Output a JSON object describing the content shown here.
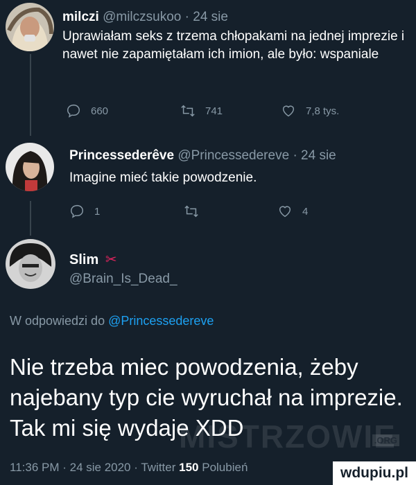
{
  "tweets": [
    {
      "name": "milczi",
      "handle": "@milczsukoo",
      "time": "· 24 sie",
      "text": "Uprawiałam seks z trzema chłopakami na jednej imprezie i nawet nie zapamiętałam ich imion, ale było: wspaniale",
      "replies": "660",
      "retweets": "741",
      "likes": "7,8 tys."
    },
    {
      "name": "Princessederêve",
      "handle": "@Princessedereve",
      "time": "· 24 sie",
      "text": "Imagine mieć takie powodzenie.",
      "replies": "1",
      "retweets": "",
      "likes": "4"
    }
  ],
  "main_tweet": {
    "name": "Slim",
    "name_emoji": "✂",
    "handle": "@Brain_Is_Dead_",
    "reply_prefix": "W odpowiedzi do",
    "reply_to": "@Princessedereve",
    "text": "Nie trzeba miec powodzenia, żeby najebany typ cie wyruchał na imprezie. Tak mi się wydaje XDD",
    "time": "11:36 PM · 24 sie 2020 · Twitter",
    "likes_count": "150",
    "likes_label": "Polubień"
  },
  "watermark": {
    "text": "MISTRZOWIE",
    "suffix": ".ORG"
  },
  "badge": {
    "text": "wdupiu.pl"
  },
  "colors": {
    "background": "#15202b",
    "muted": "#8899a6",
    "link": "#1da1f2",
    "line": "#38444d"
  }
}
